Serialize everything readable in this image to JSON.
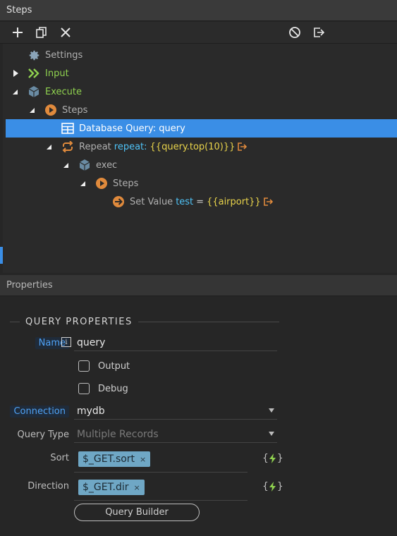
{
  "steps_panel": {
    "title": "Steps"
  },
  "toolbar": {
    "add": "plus-icon",
    "duplicate": "copy-icon",
    "delete": "close-icon",
    "disable": "disable-icon",
    "export": "export-icon"
  },
  "tree": {
    "settings": "Settings",
    "input": "Input",
    "execute": "Execute",
    "steps1": "Steps",
    "db_query": "Database Query: query",
    "repeat_prefix": "Repeat",
    "repeat_key": "repeat:",
    "repeat_expr": "{{query.top(10)}}",
    "exec": "exec",
    "steps2": "Steps",
    "setvalue_prefix": "Set Value",
    "setvalue_key": "test",
    "setvalue_eq": "=",
    "setvalue_expr": "{{airport}}"
  },
  "properties_panel": {
    "title": "Properties"
  },
  "query_properties": {
    "section_title": "QUERY PROPERTIES",
    "name_label": "Name",
    "name_value": "query",
    "info_glyph": "i",
    "output_label": "Output",
    "debug_label": "Debug",
    "connection_label": "Connection",
    "connection_value": "mydb",
    "query_type_label": "Query Type",
    "query_type_value": "Multiple Records",
    "sort_label": "Sort",
    "sort_tag": "$_GET.sort",
    "direction_label": "Direction",
    "direction_tag": "$_GET.dir",
    "tag_remove": "×",
    "brace_open": "{",
    "brace_close": "}",
    "query_builder_button": "Query Builder"
  },
  "colors": {
    "accent": "#3a8ee6",
    "green": "#8fd14f",
    "key_blue": "#4fc3f7",
    "expr_yellow": "#e9d44b",
    "step_orange": "#e08a3c",
    "tag_bg": "#6fa7c5"
  }
}
